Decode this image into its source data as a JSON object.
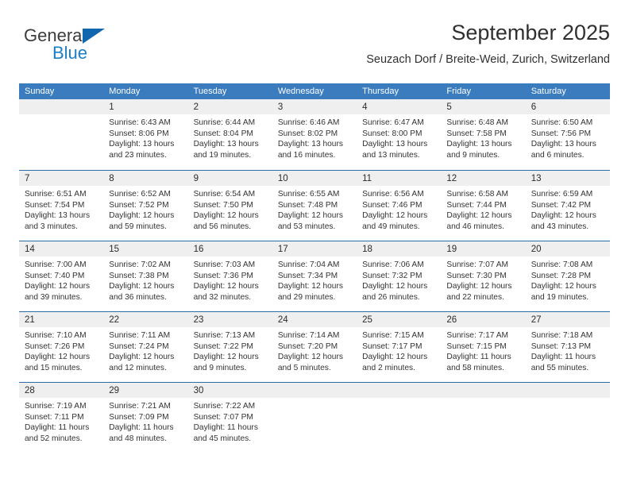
{
  "brand": {
    "name_top": "General",
    "name_bottom": "Blue",
    "accent_color": "#1a7ec4",
    "triangle_color": "#1266ad"
  },
  "header": {
    "title": "September 2025",
    "subtitle": "Seuzach Dorf / Breite-Weid, Zurich, Switzerland"
  },
  "colors": {
    "header_bar": "#3a7cbe",
    "row_separator": "#2c6ca8",
    "day_band": "#efeff0",
    "text": "#333333"
  },
  "weekdays": [
    "Sunday",
    "Monday",
    "Tuesday",
    "Wednesday",
    "Thursday",
    "Friday",
    "Saturday"
  ],
  "weeks": [
    [
      {
        "day": "",
        "lines": [
          "",
          "",
          "",
          ""
        ]
      },
      {
        "day": "1",
        "lines": [
          "Sunrise: 6:43 AM",
          "Sunset: 8:06 PM",
          "Daylight: 13 hours",
          "and 23 minutes."
        ]
      },
      {
        "day": "2",
        "lines": [
          "Sunrise: 6:44 AM",
          "Sunset: 8:04 PM",
          "Daylight: 13 hours",
          "and 19 minutes."
        ]
      },
      {
        "day": "3",
        "lines": [
          "Sunrise: 6:46 AM",
          "Sunset: 8:02 PM",
          "Daylight: 13 hours",
          "and 16 minutes."
        ]
      },
      {
        "day": "4",
        "lines": [
          "Sunrise: 6:47 AM",
          "Sunset: 8:00 PM",
          "Daylight: 13 hours",
          "and 13 minutes."
        ]
      },
      {
        "day": "5",
        "lines": [
          "Sunrise: 6:48 AM",
          "Sunset: 7:58 PM",
          "Daylight: 13 hours",
          "and 9 minutes."
        ]
      },
      {
        "day": "6",
        "lines": [
          "Sunrise: 6:50 AM",
          "Sunset: 7:56 PM",
          "Daylight: 13 hours",
          "and 6 minutes."
        ]
      }
    ],
    [
      {
        "day": "7",
        "lines": [
          "Sunrise: 6:51 AM",
          "Sunset: 7:54 PM",
          "Daylight: 13 hours",
          "and 3 minutes."
        ]
      },
      {
        "day": "8",
        "lines": [
          "Sunrise: 6:52 AM",
          "Sunset: 7:52 PM",
          "Daylight: 12 hours",
          "and 59 minutes."
        ]
      },
      {
        "day": "9",
        "lines": [
          "Sunrise: 6:54 AM",
          "Sunset: 7:50 PM",
          "Daylight: 12 hours",
          "and 56 minutes."
        ]
      },
      {
        "day": "10",
        "lines": [
          "Sunrise: 6:55 AM",
          "Sunset: 7:48 PM",
          "Daylight: 12 hours",
          "and 53 minutes."
        ]
      },
      {
        "day": "11",
        "lines": [
          "Sunrise: 6:56 AM",
          "Sunset: 7:46 PM",
          "Daylight: 12 hours",
          "and 49 minutes."
        ]
      },
      {
        "day": "12",
        "lines": [
          "Sunrise: 6:58 AM",
          "Sunset: 7:44 PM",
          "Daylight: 12 hours",
          "and 46 minutes."
        ]
      },
      {
        "day": "13",
        "lines": [
          "Sunrise: 6:59 AM",
          "Sunset: 7:42 PM",
          "Daylight: 12 hours",
          "and 43 minutes."
        ]
      }
    ],
    [
      {
        "day": "14",
        "lines": [
          "Sunrise: 7:00 AM",
          "Sunset: 7:40 PM",
          "Daylight: 12 hours",
          "and 39 minutes."
        ]
      },
      {
        "day": "15",
        "lines": [
          "Sunrise: 7:02 AM",
          "Sunset: 7:38 PM",
          "Daylight: 12 hours",
          "and 36 minutes."
        ]
      },
      {
        "day": "16",
        "lines": [
          "Sunrise: 7:03 AM",
          "Sunset: 7:36 PM",
          "Daylight: 12 hours",
          "and 32 minutes."
        ]
      },
      {
        "day": "17",
        "lines": [
          "Sunrise: 7:04 AM",
          "Sunset: 7:34 PM",
          "Daylight: 12 hours",
          "and 29 minutes."
        ]
      },
      {
        "day": "18",
        "lines": [
          "Sunrise: 7:06 AM",
          "Sunset: 7:32 PM",
          "Daylight: 12 hours",
          "and 26 minutes."
        ]
      },
      {
        "day": "19",
        "lines": [
          "Sunrise: 7:07 AM",
          "Sunset: 7:30 PM",
          "Daylight: 12 hours",
          "and 22 minutes."
        ]
      },
      {
        "day": "20",
        "lines": [
          "Sunrise: 7:08 AM",
          "Sunset: 7:28 PM",
          "Daylight: 12 hours",
          "and 19 minutes."
        ]
      }
    ],
    [
      {
        "day": "21",
        "lines": [
          "Sunrise: 7:10 AM",
          "Sunset: 7:26 PM",
          "Daylight: 12 hours",
          "and 15 minutes."
        ]
      },
      {
        "day": "22",
        "lines": [
          "Sunrise: 7:11 AM",
          "Sunset: 7:24 PM",
          "Daylight: 12 hours",
          "and 12 minutes."
        ]
      },
      {
        "day": "23",
        "lines": [
          "Sunrise: 7:13 AM",
          "Sunset: 7:22 PM",
          "Daylight: 12 hours",
          "and 9 minutes."
        ]
      },
      {
        "day": "24",
        "lines": [
          "Sunrise: 7:14 AM",
          "Sunset: 7:20 PM",
          "Daylight: 12 hours",
          "and 5 minutes."
        ]
      },
      {
        "day": "25",
        "lines": [
          "Sunrise: 7:15 AM",
          "Sunset: 7:17 PM",
          "Daylight: 12 hours",
          "and 2 minutes."
        ]
      },
      {
        "day": "26",
        "lines": [
          "Sunrise: 7:17 AM",
          "Sunset: 7:15 PM",
          "Daylight: 11 hours",
          "and 58 minutes."
        ]
      },
      {
        "day": "27",
        "lines": [
          "Sunrise: 7:18 AM",
          "Sunset: 7:13 PM",
          "Daylight: 11 hours",
          "and 55 minutes."
        ]
      }
    ],
    [
      {
        "day": "28",
        "lines": [
          "Sunrise: 7:19 AM",
          "Sunset: 7:11 PM",
          "Daylight: 11 hours",
          "and 52 minutes."
        ]
      },
      {
        "day": "29",
        "lines": [
          "Sunrise: 7:21 AM",
          "Sunset: 7:09 PM",
          "Daylight: 11 hours",
          "and 48 minutes."
        ]
      },
      {
        "day": "30",
        "lines": [
          "Sunrise: 7:22 AM",
          "Sunset: 7:07 PM",
          "Daylight: 11 hours",
          "and 45 minutes."
        ]
      },
      {
        "day": "",
        "lines": [
          "",
          "",
          "",
          ""
        ]
      },
      {
        "day": "",
        "lines": [
          "",
          "",
          "",
          ""
        ]
      },
      {
        "day": "",
        "lines": [
          "",
          "",
          "",
          ""
        ]
      },
      {
        "day": "",
        "lines": [
          "",
          "",
          "",
          ""
        ]
      }
    ]
  ]
}
